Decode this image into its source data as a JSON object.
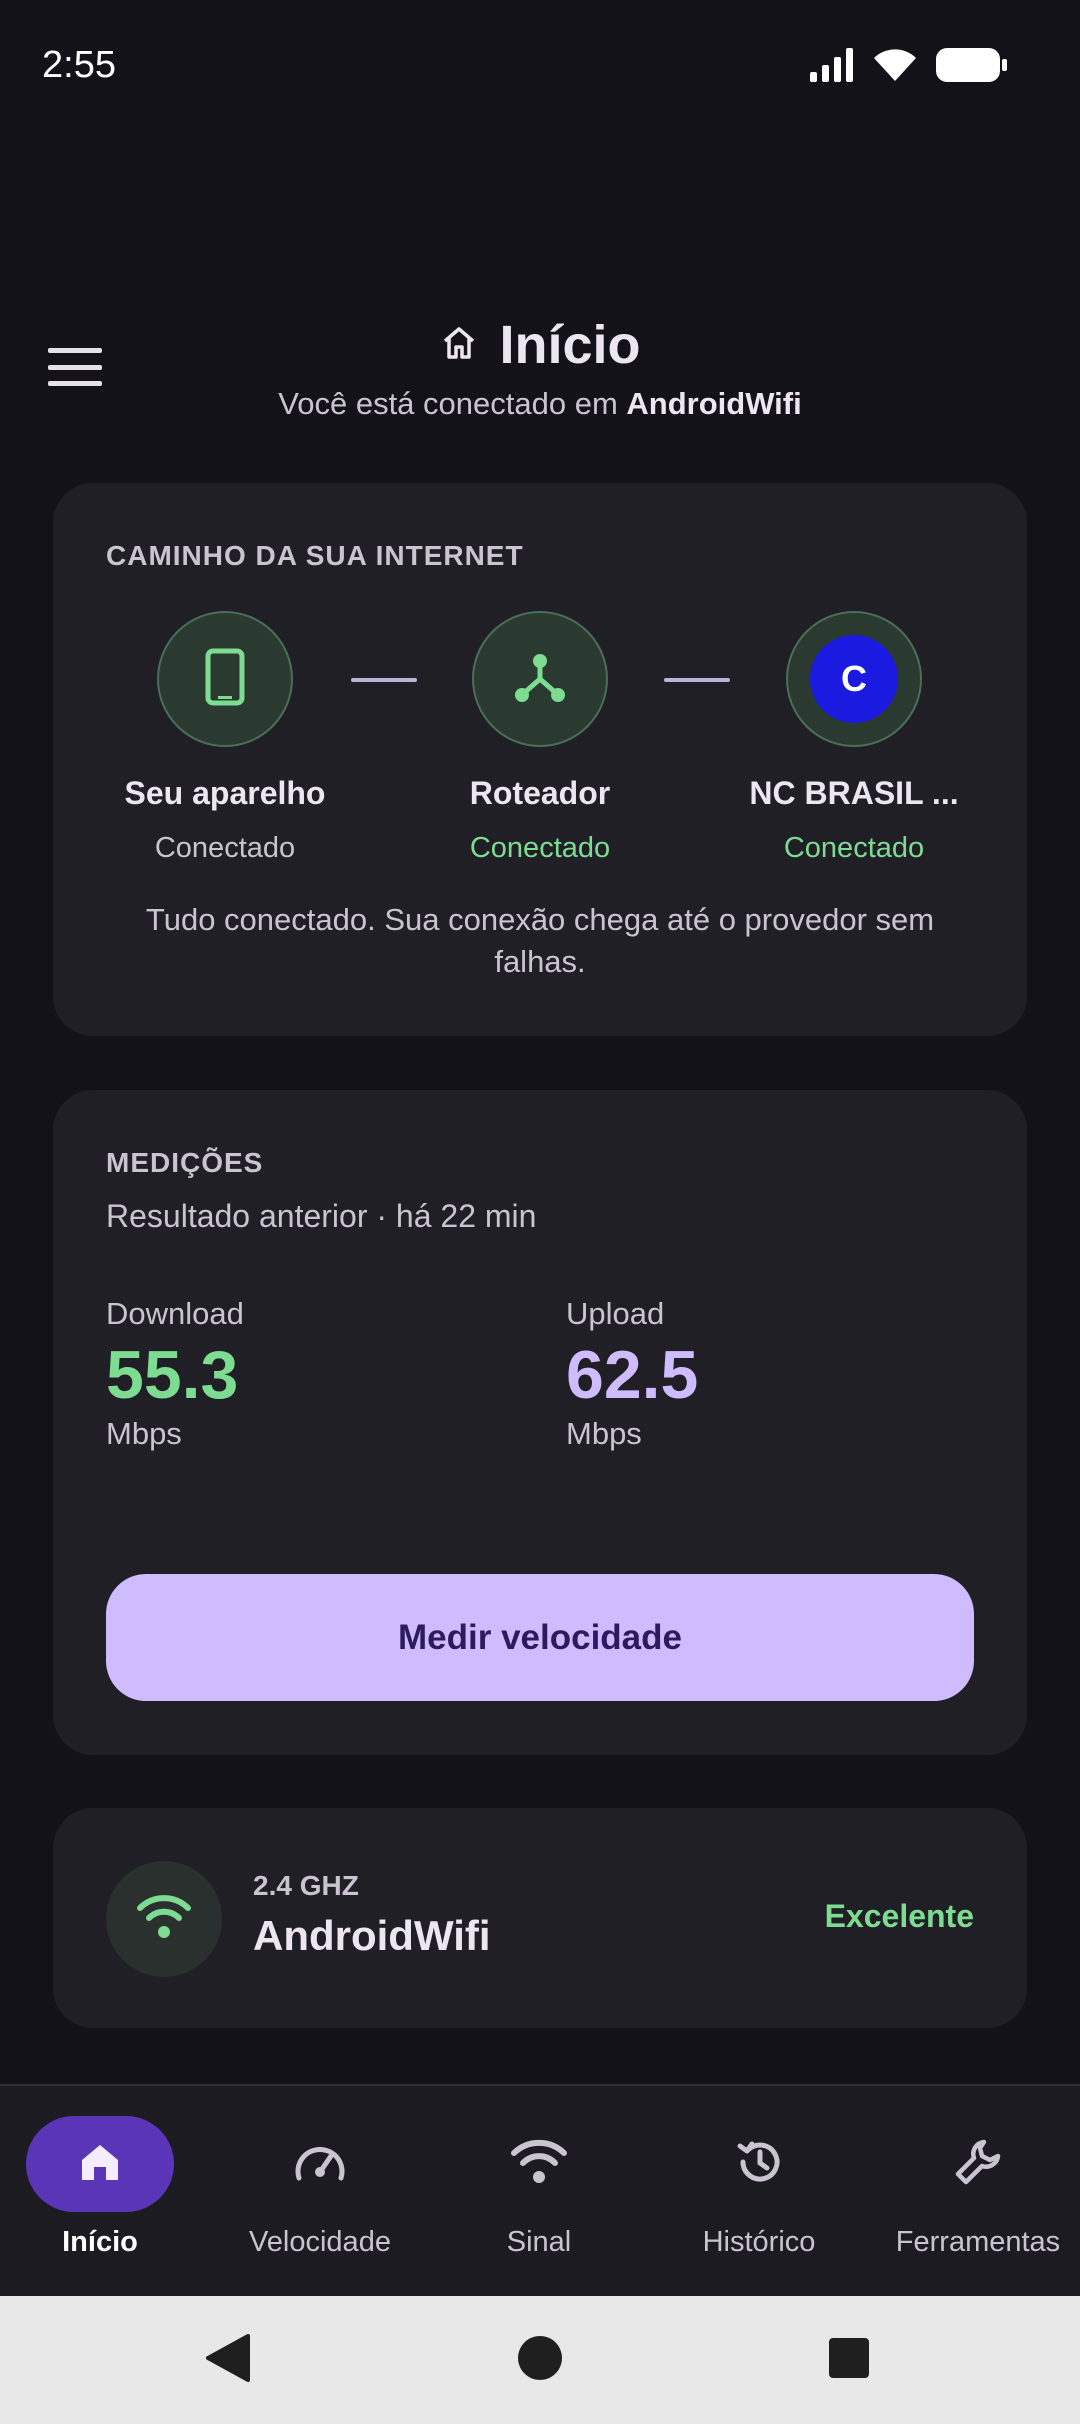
{
  "status_bar": {
    "time": "2:55",
    "icons": [
      "signal-icon",
      "wifi-icon",
      "battery-icon"
    ]
  },
  "header": {
    "icon": "home-icon",
    "title": "Início",
    "subtitle_prefix": "Você está conectado em ",
    "subtitle_network": "AndroidWifi"
  },
  "path_card": {
    "label": "CAMINHO DA SUA INTERNET",
    "nodes": [
      {
        "icon": "phone-icon",
        "name": "Seu aparelho",
        "status": "Conectado",
        "status_ok": false
      },
      {
        "icon": "router-icon",
        "name": "Roteador",
        "status": "Conectado",
        "status_ok": true
      },
      {
        "icon": "provider-icon",
        "provider_letter": "C",
        "name": "NC BRASIL ...",
        "status": "Conectado",
        "status_ok": true
      }
    ],
    "footer": "Tudo conectado. Sua conexão chega até o provedor sem falhas."
  },
  "measure_card": {
    "label": "MEDIÇÕES",
    "previous": "Resultado anterior · há 22 min",
    "download": {
      "label": "Download",
      "value": "55.3",
      "unit": "Mbps",
      "color": "#7DDC91"
    },
    "upload": {
      "label": "Upload",
      "value": "62.5",
      "unit": "Mbps",
      "color": "#CFBCFF"
    },
    "button_label": "Medir velocidade"
  },
  "wifi_card": {
    "icon": "wifi-icon",
    "band": "2.4 GHZ",
    "ssid": "AndroidWifi",
    "quality": "Excelente"
  },
  "bottom_nav": {
    "items": [
      {
        "label": "Início",
        "icon": "home-icon",
        "active": true
      },
      {
        "label": "Velocidade",
        "icon": "speedometer-icon",
        "active": false
      },
      {
        "label": "Sinal",
        "icon": "wifi-icon",
        "active": false
      },
      {
        "label": "Histórico",
        "icon": "history-icon",
        "active": false
      },
      {
        "label": "Ferramentas",
        "icon": "wrench-icon",
        "active": false
      }
    ]
  },
  "colors": {
    "background": "#131218",
    "card": "#201F26",
    "accent_green": "#7DDC91",
    "accent_purple": "#CFBCFF",
    "nav_active": "#5A35B8",
    "provider_blue": "#1A1AE0"
  }
}
